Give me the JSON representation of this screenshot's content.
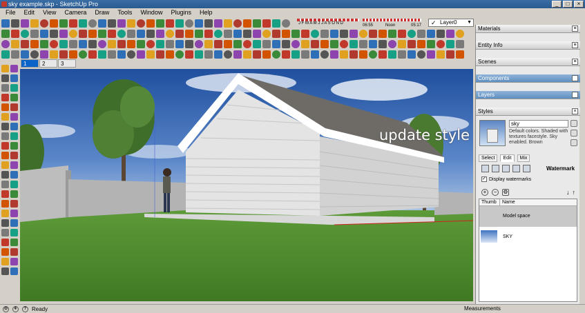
{
  "window": {
    "title": "sky example.skp - SketchUp Pro"
  },
  "menu": [
    "File",
    "Edit",
    "View",
    "Camera",
    "Draw",
    "Tools",
    "Window",
    "Plugins",
    "Help"
  ],
  "shadow_widget": {
    "months": "J F M A M J J A S O N D",
    "time_start": "06:55",
    "time_mid": "Noon",
    "time_end": "05:17"
  },
  "layer": {
    "current": "Layer0"
  },
  "scene_tabs": [
    "1",
    "2",
    "3"
  ],
  "viewport": {
    "overlay": "update style"
  },
  "trays": {
    "materials": "Materials",
    "entity_info": "Entity Info",
    "scenes": "Scenes",
    "components": "Components",
    "layers": "Layers",
    "styles": "Styles"
  },
  "styles": {
    "name": "sky",
    "description": "Default colors.  Shaded with textures facestyle.  Sky enabled.  Brown",
    "tabs": [
      "Select",
      "Edit",
      "Mix"
    ],
    "section": "Watermark",
    "display_watermarks": "Display watermarks",
    "table": {
      "col_thumb": "Thumb",
      "col_name": "Name",
      "rows": [
        "Model space",
        "SKY"
      ]
    }
  },
  "status": {
    "text": "Ready",
    "measurements": "Measurements"
  },
  "colors": {
    "sky": "#2f62b0",
    "grass": "#4f8a2e",
    "siding": "#e6e6e6",
    "roof": "#6e6a65",
    "wall": "#b9b9b9"
  }
}
